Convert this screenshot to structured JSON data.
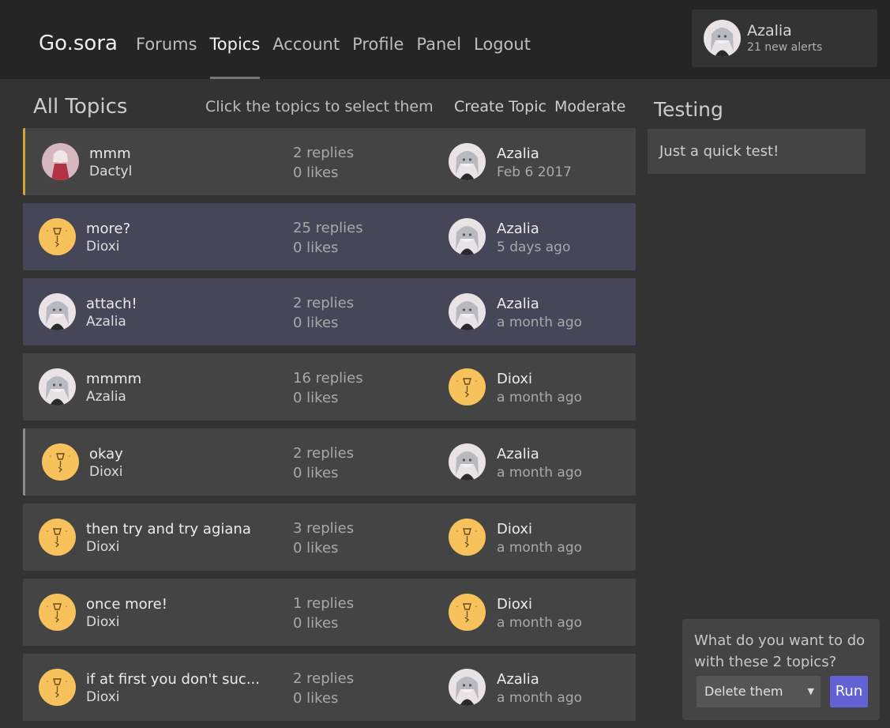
{
  "header": {
    "brand": "Go.sora",
    "nav": [
      "Forums",
      "Topics",
      "Account",
      "Profile",
      "Panel",
      "Logout"
    ],
    "active_nav": "Topics",
    "user": {
      "name": "Azalia",
      "alerts": "21 new alerts",
      "avatar": "azalia-avatar"
    }
  },
  "list": {
    "title": "All Topics",
    "hint": "Click the topics to select them",
    "create_label": "Create Topic",
    "moderate_label": "Moderate"
  },
  "topics": [
    {
      "title": "mmm",
      "author": "Dactyl",
      "author_avatar": "dactyl-avatar",
      "replies": "2 replies",
      "likes": "0 likes",
      "last_user": "Azalia",
      "last_avatar": "azalia-avatar",
      "last_time": "Feb 6 2017",
      "state": "pinned"
    },
    {
      "title": "more?",
      "author": "Dioxi",
      "author_avatar": "dioxi-avatar",
      "replies": "25 replies",
      "likes": "0 likes",
      "last_user": "Azalia",
      "last_avatar": "azalia-avatar",
      "last_time": "5 days ago",
      "state": "selected"
    },
    {
      "title": "attach!",
      "author": "Azalia",
      "author_avatar": "azalia-avatar",
      "replies": "2 replies",
      "likes": "0 likes",
      "last_user": "Azalia",
      "last_avatar": "azalia-avatar",
      "last_time": "a month ago",
      "state": "selected"
    },
    {
      "title": "mmmm",
      "author": "Azalia",
      "author_avatar": "azalia-avatar",
      "replies": "16 replies",
      "likes": "0 likes",
      "last_user": "Dioxi",
      "last_avatar": "dioxi-avatar",
      "last_time": "a month ago",
      "state": "normal"
    },
    {
      "title": "okay",
      "author": "Dioxi",
      "author_avatar": "dioxi-avatar",
      "replies": "2 replies",
      "likes": "0 likes",
      "last_user": "Azalia",
      "last_avatar": "azalia-avatar",
      "last_time": "a month ago",
      "state": "closed"
    },
    {
      "title": "then try and try agiana",
      "author": "Dioxi",
      "author_avatar": "dioxi-avatar",
      "replies": "3 replies",
      "likes": "0 likes",
      "last_user": "Dioxi",
      "last_avatar": "dioxi-avatar",
      "last_time": "a month ago",
      "state": "normal"
    },
    {
      "title": "once more!",
      "author": "Dioxi",
      "author_avatar": "dioxi-avatar",
      "replies": "1 replies",
      "likes": "0 likes",
      "last_user": "Dioxi",
      "last_avatar": "dioxi-avatar",
      "last_time": "a month ago",
      "state": "normal"
    },
    {
      "title": "if at first you don't suc...",
      "author": "Dioxi",
      "author_avatar": "dioxi-avatar",
      "replies": "2 replies",
      "likes": "0 likes",
      "last_user": "Azalia",
      "last_avatar": "azalia-avatar",
      "last_time": "a month ago",
      "state": "normal"
    }
  ],
  "sidebar": {
    "title": "Testing",
    "text": "Just a quick test!"
  },
  "moderation": {
    "question": "What do you want to do with these 2 topics?",
    "selected_action": "Delete them",
    "run_label": "Run"
  },
  "colors": {
    "background": "#333333",
    "header": "#252525",
    "row": "#444444",
    "row_selected": "#464659",
    "pinned_accent": "#d4a33a",
    "closed_accent": "#8a8a8a",
    "run_button": "#6262d4"
  }
}
